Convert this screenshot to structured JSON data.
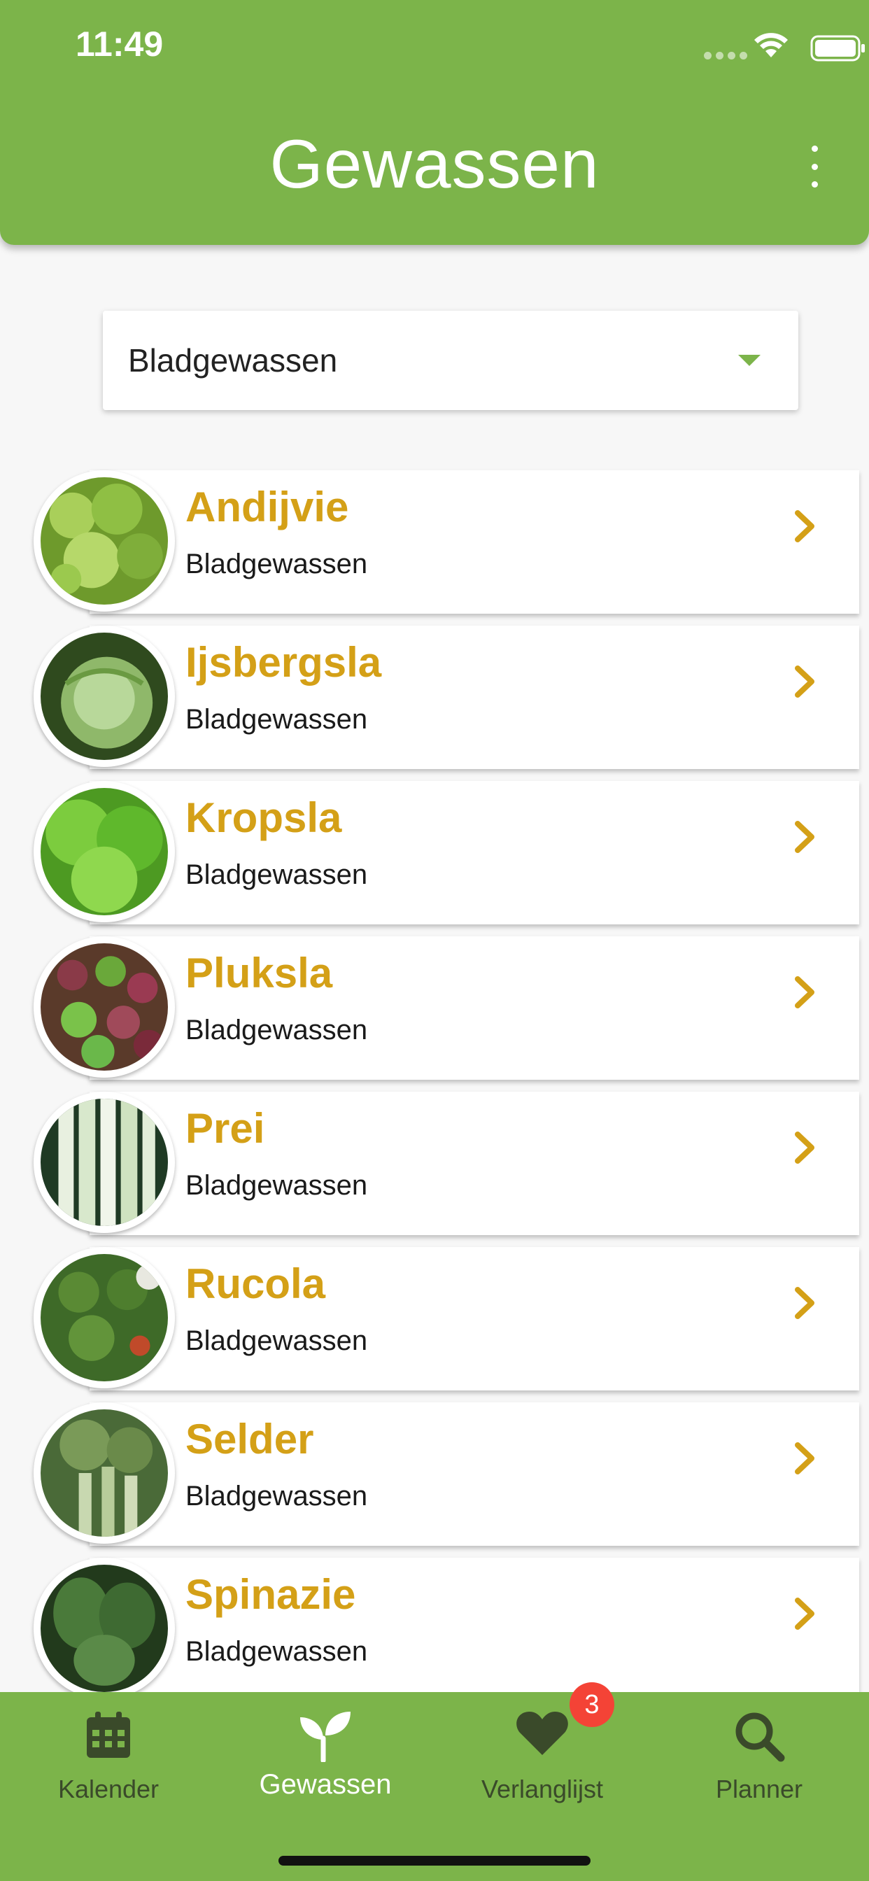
{
  "status_bar": {
    "time": "11:49"
  },
  "header": {
    "title": "Gewassen",
    "menu_icon": "more-vertical-icon"
  },
  "category_filter": {
    "selected": "Bladgewassen",
    "icon": "dropdown-caret-icon"
  },
  "crops": [
    {
      "name": "Andijvie",
      "category": "Bladgewassen"
    },
    {
      "name": "Ijsbergsla",
      "category": "Bladgewassen"
    },
    {
      "name": "Kropsla",
      "category": "Bladgewassen"
    },
    {
      "name": "Pluksla",
      "category": "Bladgewassen"
    },
    {
      "name": "Prei",
      "category": "Bladgewassen"
    },
    {
      "name": "Rucola",
      "category": "Bladgewassen"
    },
    {
      "name": "Selder",
      "category": "Bladgewassen"
    },
    {
      "name": "Spinazie",
      "category": "Bladgewassen"
    }
  ],
  "bottom_nav": {
    "items": [
      {
        "label": "Kalender",
        "icon": "calendar-icon"
      },
      {
        "label": "Gewassen",
        "icon": "sprout-icon"
      },
      {
        "label": "Verlanglijst",
        "icon": "heart-icon",
        "badge": "3"
      },
      {
        "label": "Planner",
        "icon": "search-icon"
      }
    ],
    "active": "Gewassen"
  },
  "colors": {
    "primary_green": "#7cb44a",
    "crop_name": "#d4a017",
    "badge": "#f44336",
    "nav_inactive": "#3a4a2a"
  }
}
